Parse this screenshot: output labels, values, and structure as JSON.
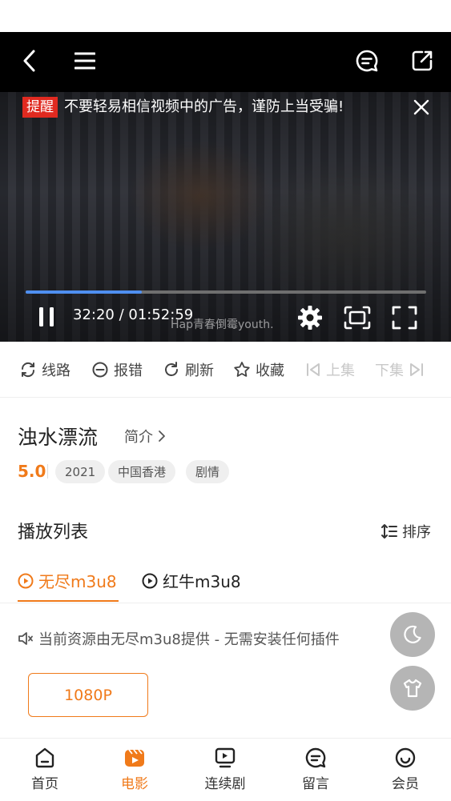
{
  "player": {
    "notice_tag": "提醒",
    "notice_text": "不要轻易相信视频中的广告，谨防上当受骗!",
    "time": "32:20 / 01:52:59",
    "subtitle": "Hap青春倒霉youth.",
    "progress": 0.29
  },
  "actions": {
    "route": "线路",
    "report": "报错",
    "refresh": "刷新",
    "favorite": "收藏",
    "prev": "上集",
    "next": "下集"
  },
  "movie": {
    "title": "浊水漂流",
    "intro_label": "简介",
    "rating": "5.0",
    "tags": [
      "2021",
      "中国香港",
      "剧情"
    ]
  },
  "playlist": {
    "title": "播放列表",
    "sort_label": "排序",
    "sources": [
      {
        "label": "无尽m3u8",
        "active": true
      },
      {
        "label": "红牛m3u8",
        "active": false
      }
    ],
    "info": "当前资源由无尽m3u8提供 - 无需安装任何插件",
    "quality": "1080P"
  },
  "tabbar": {
    "items": [
      {
        "label": "首页",
        "icon": "home-icon"
      },
      {
        "label": "电影",
        "icon": "movie-icon"
      },
      {
        "label": "连续剧",
        "icon": "tv-series-icon"
      },
      {
        "label": "留言",
        "icon": "message-icon"
      },
      {
        "label": "会员",
        "icon": "member-icon"
      }
    ],
    "active_index": 1
  },
  "colors": {
    "accent": "#f07a1a",
    "notice_red": "#e02a20",
    "progress_blue": "#4f8ff0"
  }
}
